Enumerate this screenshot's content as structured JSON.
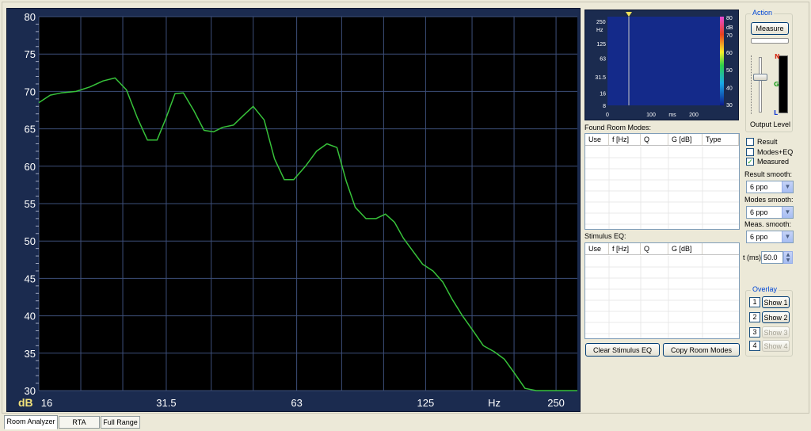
{
  "chart_data": {
    "type": "line",
    "x_scale": "log",
    "xlim": [
      16,
      280
    ],
    "ylim": [
      30,
      80
    ],
    "x_ticks": [
      {
        "value": 16,
        "label": "16"
      },
      {
        "value": 31.5,
        "label": "31.5"
      },
      {
        "value": 63,
        "label": "63"
      },
      {
        "value": 125,
        "label": "125"
      },
      {
        "value": 250,
        "label": "250"
      }
    ],
    "x_unit_label": "Hz",
    "x_unit_at": 180,
    "y_ticks": [
      30,
      35,
      40,
      45,
      50,
      55,
      60,
      65,
      70,
      75,
      80
    ],
    "y_unit_label": "dB",
    "grid": true,
    "series": [
      {
        "color": "#37c23a",
        "x": [
          16,
          17,
          18,
          19.5,
          21,
          22.5,
          24,
          25.5,
          27,
          28.5,
          30,
          31.5,
          33,
          34.5,
          36.5,
          38.5,
          40.5,
          42.5,
          45,
          47.5,
          50,
          53,
          56,
          59,
          62,
          66,
          70,
          74,
          78,
          82,
          86,
          91,
          96,
          101,
          106,
          111,
          117,
          123,
          130,
          137,
          144,
          152,
          160,
          170,
          180,
          190,
          200,
          212,
          225,
          240,
          255,
          270,
          280
        ],
        "y": [
          68.5,
          69.5,
          69.8,
          70.0,
          70.6,
          71.4,
          71.8,
          70.2,
          66.5,
          63.5,
          63.5,
          66.5,
          69.7,
          69.8,
          67.4,
          64.8,
          64.6,
          65.2,
          65.5,
          66.8,
          68.0,
          66.2,
          61.0,
          58.2,
          58.2,
          60.0,
          62.0,
          63.0,
          62.5,
          58.0,
          54.5,
          53.0,
          53.0,
          53.6,
          52.5,
          50.4,
          48.6,
          46.9,
          46.0,
          44.5,
          42.2,
          40.0,
          38.2,
          36.0,
          35.2,
          34.2,
          32.4,
          30.3,
          30.0,
          30.0,
          30.0,
          30.0,
          30.0
        ]
      }
    ]
  },
  "spectrogram": {
    "y_unit": "Hz",
    "y_ticks": [
      "250",
      "125",
      "63",
      "31.5",
      "16",
      "8"
    ],
    "x_ticks": [
      "0",
      "100",
      "200"
    ],
    "x_unit": "ms",
    "scale_unit": "dB",
    "scale_ticks": [
      "80",
      "70",
      "60",
      "50",
      "40",
      "30"
    ]
  },
  "found_room_modes": {
    "label": "Found Room Modes:",
    "columns": [
      "Use",
      "f [Hz]",
      "Q",
      "G [dB]",
      "Type"
    ]
  },
  "stimulus_eq": {
    "label": "Stimulus EQ:",
    "columns": [
      "Use",
      "f [Hz]",
      "Q",
      "G [dB]"
    ]
  },
  "buttons": {
    "clear_stimulus_eq": "Clear Stimulus EQ",
    "copy_room_modes": "Copy Room Modes"
  },
  "action": {
    "title": "Action",
    "measure_label": "Measure",
    "output_level_label": "Output Level",
    "level_markers": [
      "N",
      "G",
      "L"
    ]
  },
  "display_options": {
    "result_label": "Result",
    "modes_eq_label": "Modes+EQ",
    "measured_label": "Measured",
    "result_checked": false,
    "modes_eq_checked": false,
    "measured_checked": true
  },
  "smoothing": {
    "result_label": "Result smooth:",
    "result_value": "6 ppo",
    "modes_label": "Modes smooth:",
    "modes_value": "6 ppo",
    "meas_label": "Meas. smooth:",
    "meas_value": "6 ppo"
  },
  "time_field": {
    "label": "t (ms)",
    "value": "50.0"
  },
  "overlay": {
    "title": "Overlay",
    "items": [
      {
        "number": "1",
        "label": "Show 1",
        "enabled": true
      },
      {
        "number": "2",
        "label": "Show 2",
        "enabled": true
      },
      {
        "number": "3",
        "label": "Show 3",
        "enabled": false
      },
      {
        "number": "4",
        "label": "Show 4",
        "enabled": false
      }
    ]
  },
  "tabs": [
    {
      "label": "Room Analyzer",
      "active": true
    },
    {
      "label": "RTA",
      "active": false
    },
    {
      "label": "Full Range",
      "active": false
    }
  ]
}
